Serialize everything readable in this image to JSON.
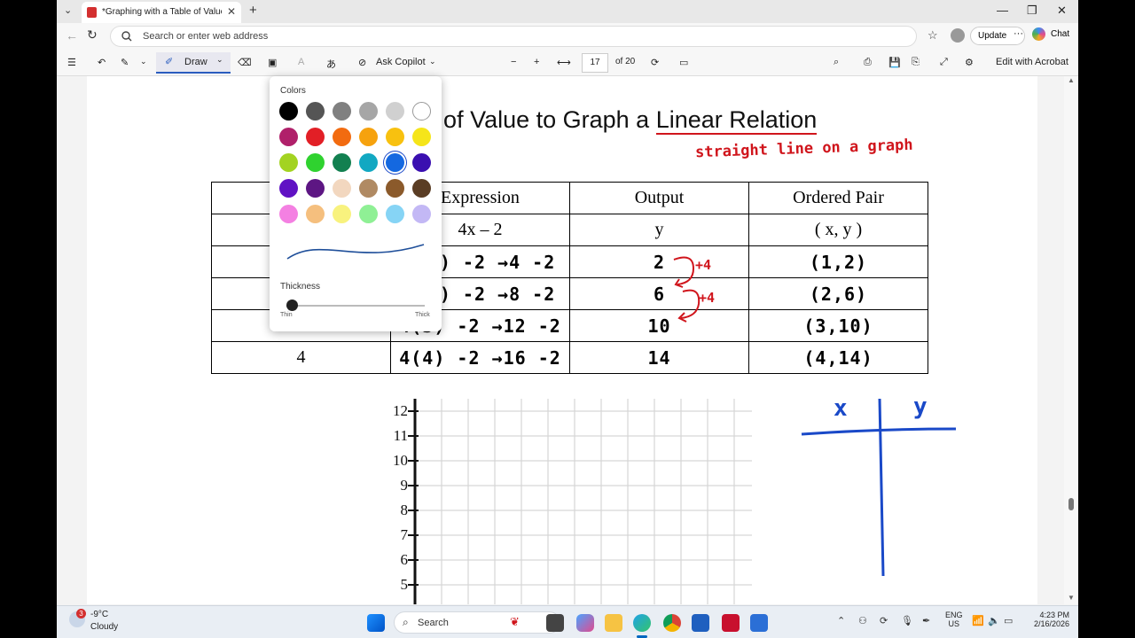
{
  "browser": {
    "tab_title": "*Graphing with a Table of Value.pdf",
    "url_placeholder": "Search or enter web address",
    "update_label": "Update",
    "chat_label": "Chat"
  },
  "pdf_toolbar": {
    "draw_label": "Draw",
    "copilot_label": "Ask Copilot",
    "page_current": "17",
    "page_total": "of 20",
    "acrobat_label": "Edit with Acrobat"
  },
  "document": {
    "title_prefix": "Table of Value to Graph a ",
    "title_underlined": "Linear Relation",
    "annotation_red": "straight line on a graph",
    "table_headers": [
      "Expression",
      "Output",
      "Ordered Pair"
    ],
    "table_subheaders": [
      "4x – 2",
      "y",
      "( x, y )"
    ],
    "rows": [
      {
        "expr": "4(1) -2 →4 -2",
        "out": "2",
        "pair": "(1,2)"
      },
      {
        "expr": "4(2) -2 →8 -2",
        "out": "6",
        "pair": "(2,6)"
      },
      {
        "expr": "4(3) -2 →12 -2",
        "out": "10",
        "pair": "(3,10)"
      },
      {
        "expr": "4(4) -2 →16 -2",
        "out": "14",
        "pair": "(4,14)"
      }
    ],
    "first_col_visible": "4",
    "diff_note_1": "+4",
    "diff_note_2": "+4",
    "graph_y_ticks": [
      "12",
      "11",
      "10",
      "9",
      "8",
      "7",
      "6",
      "5"
    ],
    "xy_table_x": "x",
    "xy_table_y": "y"
  },
  "palette": {
    "colors_label": "Colors",
    "thickness_label": "Thickness",
    "thin_label": "Thin",
    "thick_label": "Thick",
    "swatches": [
      [
        "#000000",
        "#555555",
        "#808080",
        "#a6a6a6",
        "#d0d0d0",
        "#ffffff"
      ],
      [
        "#b0206a",
        "#e21f26",
        "#f26b10",
        "#f6a20e",
        "#f8c10f",
        "#f5e51a"
      ],
      [
        "#a3d321",
        "#2fd22f",
        "#128050",
        "#12a8c2",
        "#1468e0",
        "#3a0fb0"
      ],
      [
        "#6012c4",
        "#5d1683",
        "#f2d7bf",
        "#b08a63",
        "#8b5a2b",
        "#5a3d24"
      ],
      [
        "#f480e2",
        "#f5bf7e",
        "#f8f27e",
        "#8ff095",
        "#86d4f5",
        "#c3b8f5"
      ]
    ],
    "selected_color": "#1468e0"
  },
  "taskbar": {
    "weather_temp": "-9°C",
    "weather_text": "Cloudy",
    "weather_badge": "3",
    "search_label": "Search",
    "lang1": "ENG",
    "lang2": "US",
    "time": "4:23 PM",
    "date": "2/16/2026"
  }
}
